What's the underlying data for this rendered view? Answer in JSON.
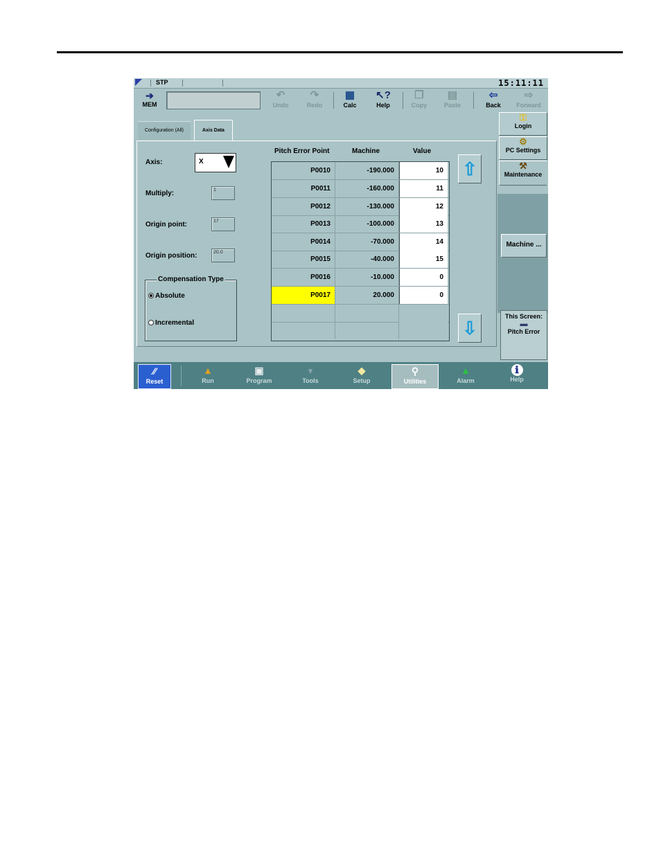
{
  "status": {
    "mode": "STP",
    "clock": "15:11:11"
  },
  "toolbar": {
    "mem_label": "MEM",
    "buttons": [
      {
        "label": "Undo",
        "icon": "undo-icon",
        "glyph": "↶",
        "enabled": false
      },
      {
        "label": "Redo",
        "icon": "redo-icon",
        "glyph": "↷",
        "enabled": false
      },
      {
        "label": "Calc",
        "icon": "calculator-icon",
        "glyph": "▦",
        "enabled": true
      },
      {
        "label": "Help",
        "icon": "help-pointer-icon",
        "glyph": "↖?",
        "enabled": true
      },
      {
        "label": "Copy",
        "icon": "copy-icon",
        "glyph": "❐",
        "enabled": false
      },
      {
        "label": "Paste",
        "icon": "paste-icon",
        "glyph": "▤",
        "enabled": false
      },
      {
        "label": "Back",
        "icon": "back-arrow-icon",
        "glyph": "⇦",
        "enabled": true
      },
      {
        "label": "Forward",
        "icon": "forward-arrow-icon",
        "glyph": "⇨",
        "enabled": false
      }
    ]
  },
  "tabs": [
    {
      "label": "Configuration (All)",
      "active": false
    },
    {
      "label": "Axis Data",
      "active": true
    }
  ],
  "form": {
    "axis_label": "Axis:",
    "axis_value": "X",
    "multiply_label": "Multiply:",
    "multiply_value": "1",
    "origin_point_label": "Origin point:",
    "origin_point_value": "17",
    "origin_position_label": "Origin position:",
    "origin_position_value": "20.0",
    "compensation_title": "Compensation Type",
    "absolute_label": "Absolute",
    "incremental_label": "Incremental",
    "selected": "Absolute"
  },
  "table": {
    "headers": [
      "Pitch Error Point",
      "Machine",
      "Value"
    ],
    "rows": [
      {
        "point": "P0010",
        "machine": "-190.000",
        "value": "10"
      },
      {
        "point": "P0011",
        "machine": "-160.000",
        "value": "11"
      },
      {
        "point": "P0012",
        "machine": "-130.000",
        "value": "12"
      },
      {
        "point": "P0013",
        "machine": "-100.000",
        "value": "13"
      },
      {
        "point": "P0014",
        "machine": "-70.000",
        "value": "14"
      },
      {
        "point": "P0015",
        "machine": "-40.000",
        "value": "15"
      },
      {
        "point": "P0016",
        "machine": "-10.000",
        "value": "0"
      },
      {
        "point": "P0017",
        "machine": "20.000",
        "value": "0",
        "highlight": true
      }
    ],
    "highlight_color": "#ffff00"
  },
  "side": {
    "login_label": "Login",
    "pc_settings_label": "PC Settings",
    "maintenance_label": "Maintenance",
    "machine_label": "Machine ...",
    "this_screen_label": "This Screen:",
    "pitch_error_label": "Pitch Error"
  },
  "nav": [
    {
      "label": "Reset",
      "icon": "reset-icon",
      "glyph": "⁄⁄"
    },
    {
      "label": "Run",
      "icon": "run-icon",
      "glyph": "▲"
    },
    {
      "label": "Program",
      "icon": "program-icon",
      "glyph": "▣"
    },
    {
      "label": "Tools",
      "icon": "tools-icon",
      "glyph": "♆"
    },
    {
      "label": "Setup",
      "icon": "setup-icon",
      "glyph": "◆"
    },
    {
      "label": "Utilities",
      "icon": "wrench-icon",
      "glyph": "⚲",
      "active": true
    },
    {
      "label": "Alarm",
      "icon": "alarm-icon",
      "glyph": "▲"
    },
    {
      "label": "Help",
      "icon": "info-icon",
      "glyph": "ℹ"
    }
  ]
}
